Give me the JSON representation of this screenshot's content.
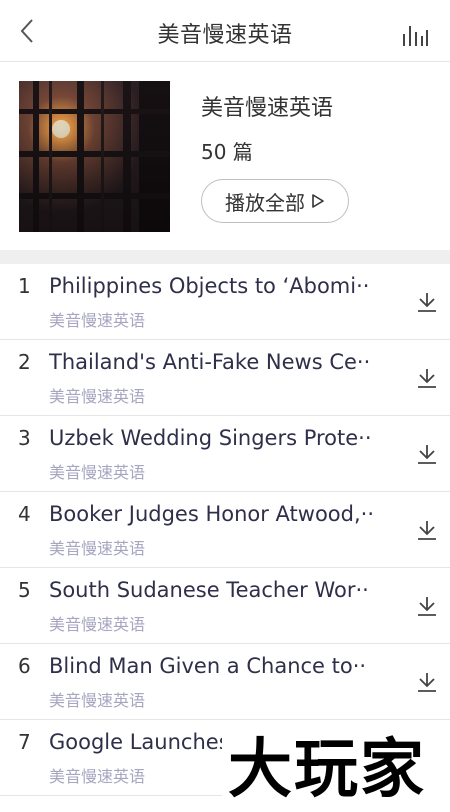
{
  "header": {
    "title": "美音慢速英语",
    "back_icon": "chevron-left-icon",
    "right_icon": "equalizer-icon"
  },
  "album": {
    "name": "美音慢速英语",
    "count": "50 篇",
    "play_all_label": "播放全部",
    "play_icon": "play-outline-icon"
  },
  "tracks": [
    {
      "num": "1",
      "title": "Philippines Objects to ‘Abomi··",
      "subtitle": "美音慢速英语"
    },
    {
      "num": "2",
      "title": "Thailand's Anti-Fake News Ce··",
      "subtitle": "美音慢速英语"
    },
    {
      "num": "3",
      "title": "Uzbek Wedding Singers Prote··",
      "subtitle": "美音慢速英语"
    },
    {
      "num": "4",
      "title": "Booker Judges Honor Atwood,··",
      "subtitle": "美音慢速英语"
    },
    {
      "num": "5",
      "title": "South Sudanese Teacher Wor··",
      "subtitle": "美音慢速英语"
    },
    {
      "num": "6",
      "title": "Blind Man Given a Chance to··",
      "subtitle": "美音慢速英语"
    },
    {
      "num": "7",
      "title": "Google Launches New Pixel P··",
      "subtitle": "美音慢速英语"
    }
  ],
  "watermark": "大玩家",
  "colors": {
    "title_text": "#2f2f4a",
    "subtitle_text": "#a6a6c0",
    "divider": "#efefef"
  }
}
